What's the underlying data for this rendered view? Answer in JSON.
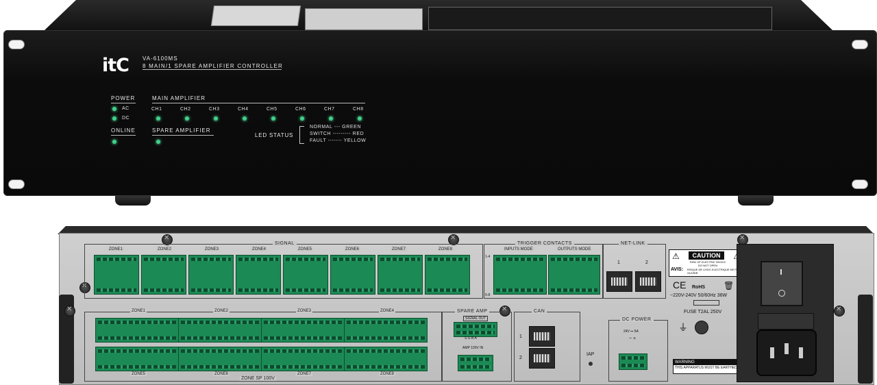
{
  "front": {
    "brand": "itC",
    "model": "VA-6100MS",
    "subtitle": "8 MAIN/1 SPARE AMPLIFIER CONTROLLER",
    "power_title": "POWER",
    "ac_label": "AC",
    "dc_label": "DC",
    "online_title": "ONLINE",
    "main_amp_title": "MAIN AMPLIFIER",
    "spare_amp_title": "SPARE AMPLIFIER",
    "channels": [
      "CH1",
      "CH2",
      "CH3",
      "CH4",
      "CH5",
      "CH6",
      "CH7",
      "CH8"
    ],
    "led_status_title": "LED STATUS",
    "status_lines": [
      "NORMAL --- GREEN",
      "SWITCH --------- RED",
      "FAULT ------- YELLOW"
    ],
    "led_color": "#3fd18a"
  },
  "rear": {
    "signal_title": "SIGNAL",
    "signal_zones": [
      "ZONE1",
      "ZONE2",
      "ZONE3",
      "ZONE4",
      "ZONE5",
      "ZONE6",
      "ZONE7",
      "ZONE8"
    ],
    "trigger_title": "TRIGGER CONTACTS",
    "inputs_mode": "INPUTS MODE",
    "outputs_mode": "OUTPUTS MODE",
    "trigger_rows": [
      "1-4",
      "5-8"
    ],
    "netlink_title": "NET-LINK",
    "netlink_ports": [
      "1",
      "2"
    ],
    "caution_title": "CAUTION",
    "caution_text": "RISK OF ELECTRIC SHOCK DO NOT OPEN",
    "avis_label": "AVIS:",
    "avis_text": "RISQUE DE CHOC ELECTRIQUE NE PAS OUVRIR",
    "ce_mark": "CE",
    "rohs_mark": "RoHS",
    "power_rating": "~220V-240V  50/60Hz 36W",
    "fuse_label": "FUSE T2AL 250V",
    "speaker_zones_top": [
      "ZONE1",
      "ZONE2",
      "ZONE3",
      "ZONE4"
    ],
    "speaker_zones_bottom": [
      "ZONE5",
      "ZONE6",
      "ZONE7",
      "ZONE8"
    ],
    "zone_sp_label": "ZONE  SP 100V",
    "spare_amp_title": "SPARE AMP",
    "signal_out_label": "SIGNAL OUT",
    "sgba_labels": "S  G  B  A",
    "amp_in_label": "AMP 100V IN",
    "can_title": "CAN",
    "can_ports": [
      "1",
      "2"
    ],
    "iap_label": "IAP",
    "dc_power_title": "DC POWER",
    "dc_rating": "24V ⎓ 5A",
    "dc_polarity": "−   +",
    "warning_title": "WARNING",
    "warning_text": "THIS APPARATUS MUST BE EARTHED"
  }
}
